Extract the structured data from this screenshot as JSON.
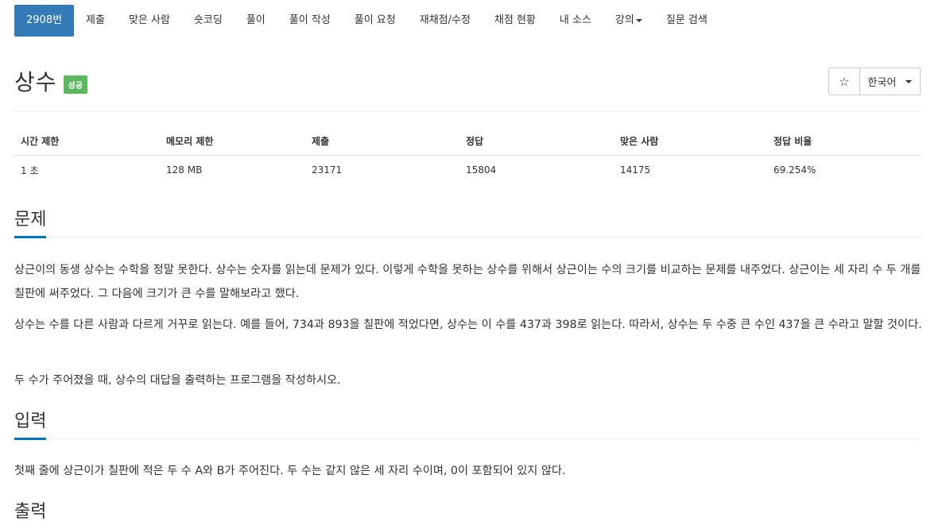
{
  "tabs": [
    {
      "label": "2908번",
      "active": true
    },
    {
      "label": "제출"
    },
    {
      "label": "맞은 사람"
    },
    {
      "label": "숏코딩"
    },
    {
      "label": "풀이"
    },
    {
      "label": "풀이 작성"
    },
    {
      "label": "풀이 요청"
    },
    {
      "label": "재채점/수정"
    },
    {
      "label": "채점 현황"
    },
    {
      "label": "내 소스"
    },
    {
      "label": "강의",
      "dropdown": true
    },
    {
      "label": "질문 검색"
    }
  ],
  "problem": {
    "title": "상수",
    "badge": "성공",
    "badge_color": "#5cb85c",
    "star_icon": "☆",
    "language": "한국어"
  },
  "stats": {
    "headers": [
      "시간 제한",
      "메모리 제한",
      "제출",
      "정답",
      "맞은 사람",
      "정답 비율"
    ],
    "values": [
      "1 초",
      "128 MB",
      "23171",
      "15804",
      "14175",
      "69.254%"
    ]
  },
  "sections": {
    "problem": {
      "heading": "문제",
      "paragraphs": [
        "상근이의 동생 상수는 수학을 정말 못한다. 상수는 숫자를 읽는데 문제가 있다. 이렇게 수학을 못하는 상수를 위해서 상근이는 수의 크기를 비교하는 문제를 내주었다. 상근이는 세 자리 수 두 개를 칠판에 써주었다. 그 다음에 크기가 큰 수를 말해보라고 했다.",
        "상수는 수를 다른 사람과 다르게 거꾸로 읽는다. 예를 들어, 734과 893을 칠판에 적었다면, 상수는 이 수를 437과 398로 읽는다. 따라서, 상수는 두 수중 큰 수인 437을 큰 수라고 말할 것이다.",
        "두 수가 주어졌을 때, 상수의 대답을 출력하는 프로그램을 작성하시오."
      ]
    },
    "input": {
      "heading": "입력",
      "paragraphs": [
        "첫째 줄에 상근이가 칠판에 적은 두 수 A와 B가 주어진다. 두 수는 같지 않은 세 자리 수이며, 0이 포함되어 있지 않다."
      ]
    },
    "output": {
      "heading": "출력"
    }
  },
  "colors": {
    "accent": "#337ab7",
    "section_underline": "#0076c0"
  }
}
